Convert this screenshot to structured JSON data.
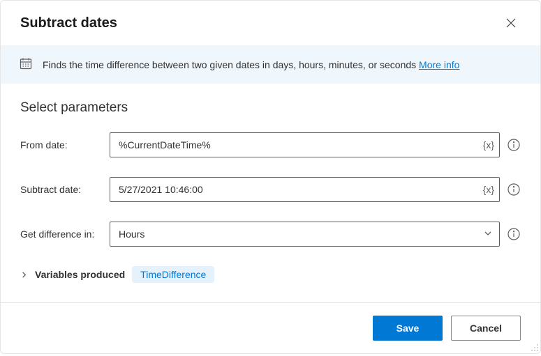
{
  "dialog": {
    "title": "Subtract dates",
    "banner_text": "Finds the time difference between two given dates in days, hours, minutes, or seconds ",
    "more_info": "More info"
  },
  "params": {
    "section_title": "Select parameters",
    "from_date": {
      "label": "From date:",
      "value": "%CurrentDateTime%"
    },
    "subtract_date": {
      "label": "Subtract date:",
      "value": "5/27/2021 10:46:00"
    },
    "get_diff": {
      "label": "Get difference in:",
      "value": "Hours"
    },
    "var_token": "{x}"
  },
  "vars": {
    "label": "Variables produced",
    "chip": "TimeDifference"
  },
  "footer": {
    "save": "Save",
    "cancel": "Cancel"
  }
}
